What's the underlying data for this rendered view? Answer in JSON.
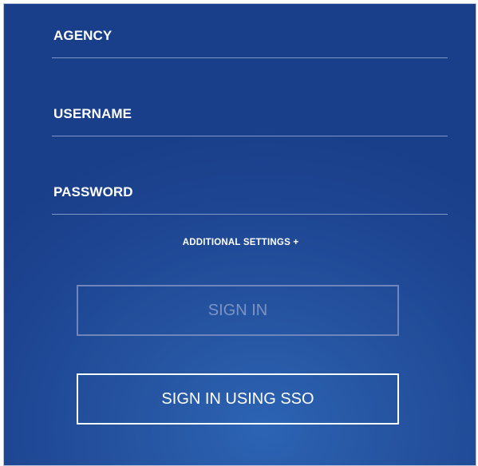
{
  "form": {
    "fields": [
      {
        "label": "AGENCY",
        "value": "",
        "placeholder": ""
      },
      {
        "label": "USERNAME",
        "value": "",
        "placeholder": ""
      },
      {
        "label": "PASSWORD",
        "value": "",
        "placeholder": ""
      }
    ],
    "additional_settings_label": "ADDITIONAL SETTINGS +",
    "sign_in_label": "SIGN IN",
    "sign_in_sso_label": "SIGN IN USING SSO"
  },
  "colors": {
    "background": "#1d4592",
    "field_underline": "#7f98c8",
    "disabled_button": "#6e86ba",
    "text": "#ffffff"
  }
}
